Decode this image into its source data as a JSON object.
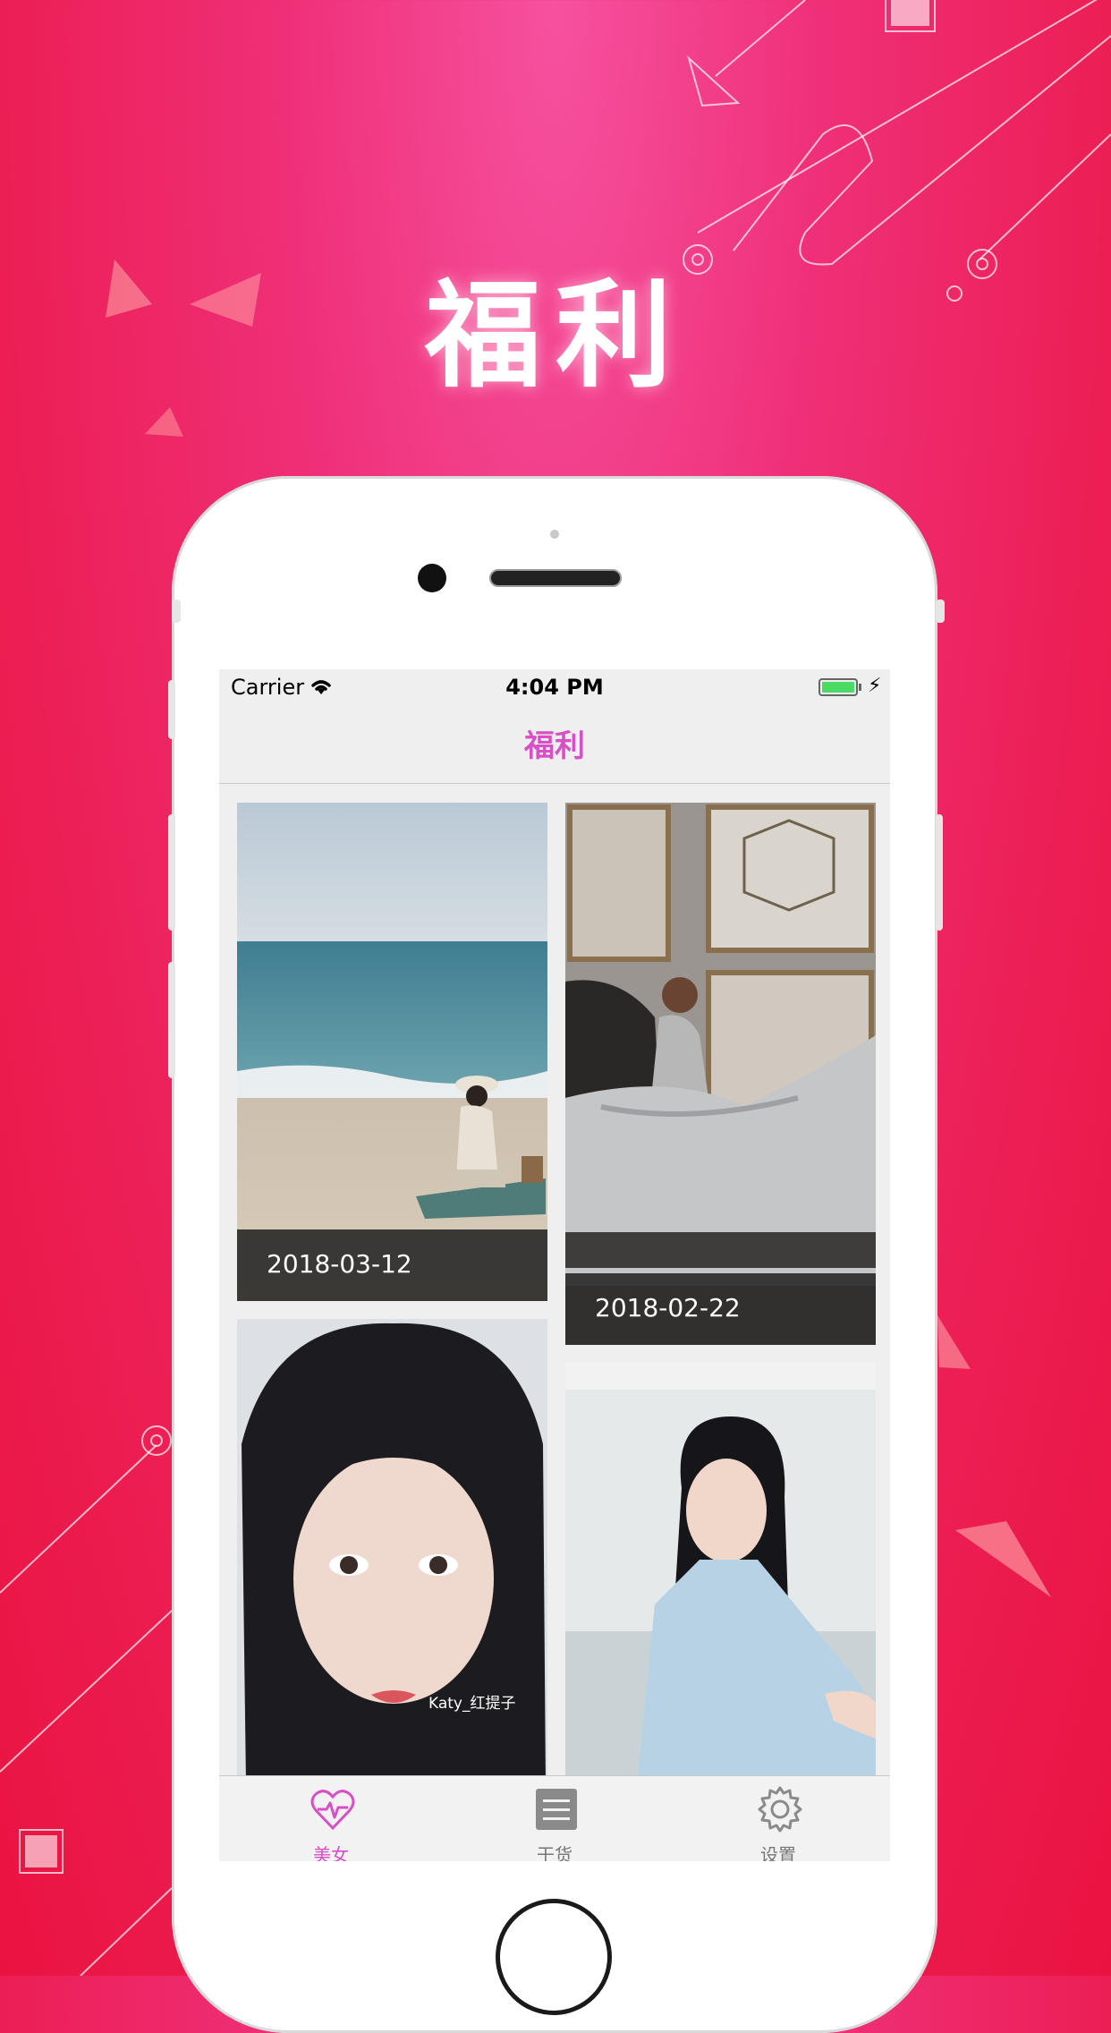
{
  "hero": {
    "title": "福利"
  },
  "status_bar": {
    "carrier": "Carrier",
    "time": "4:04 PM"
  },
  "nav": {
    "title": "福利"
  },
  "cards": [
    {
      "date": "2018-03-12",
      "alt": "beach photo"
    },
    {
      "date": "2018-02-22",
      "alt": "gown photo"
    },
    {
      "watermark": "Katy_红提子",
      "alt": "portrait photo"
    },
    {
      "alt": "sweater photo"
    }
  ],
  "tabs": [
    {
      "label": "美女",
      "icon": "heart-pulse-icon",
      "active": true
    },
    {
      "label": "干货",
      "icon": "list-icon",
      "active": false
    },
    {
      "label": "设置",
      "icon": "gear-icon",
      "active": false
    }
  ],
  "colors": {
    "accent": "#d84fc6",
    "background_top": "#f6519f",
    "background_bottom": "#ea1340"
  }
}
